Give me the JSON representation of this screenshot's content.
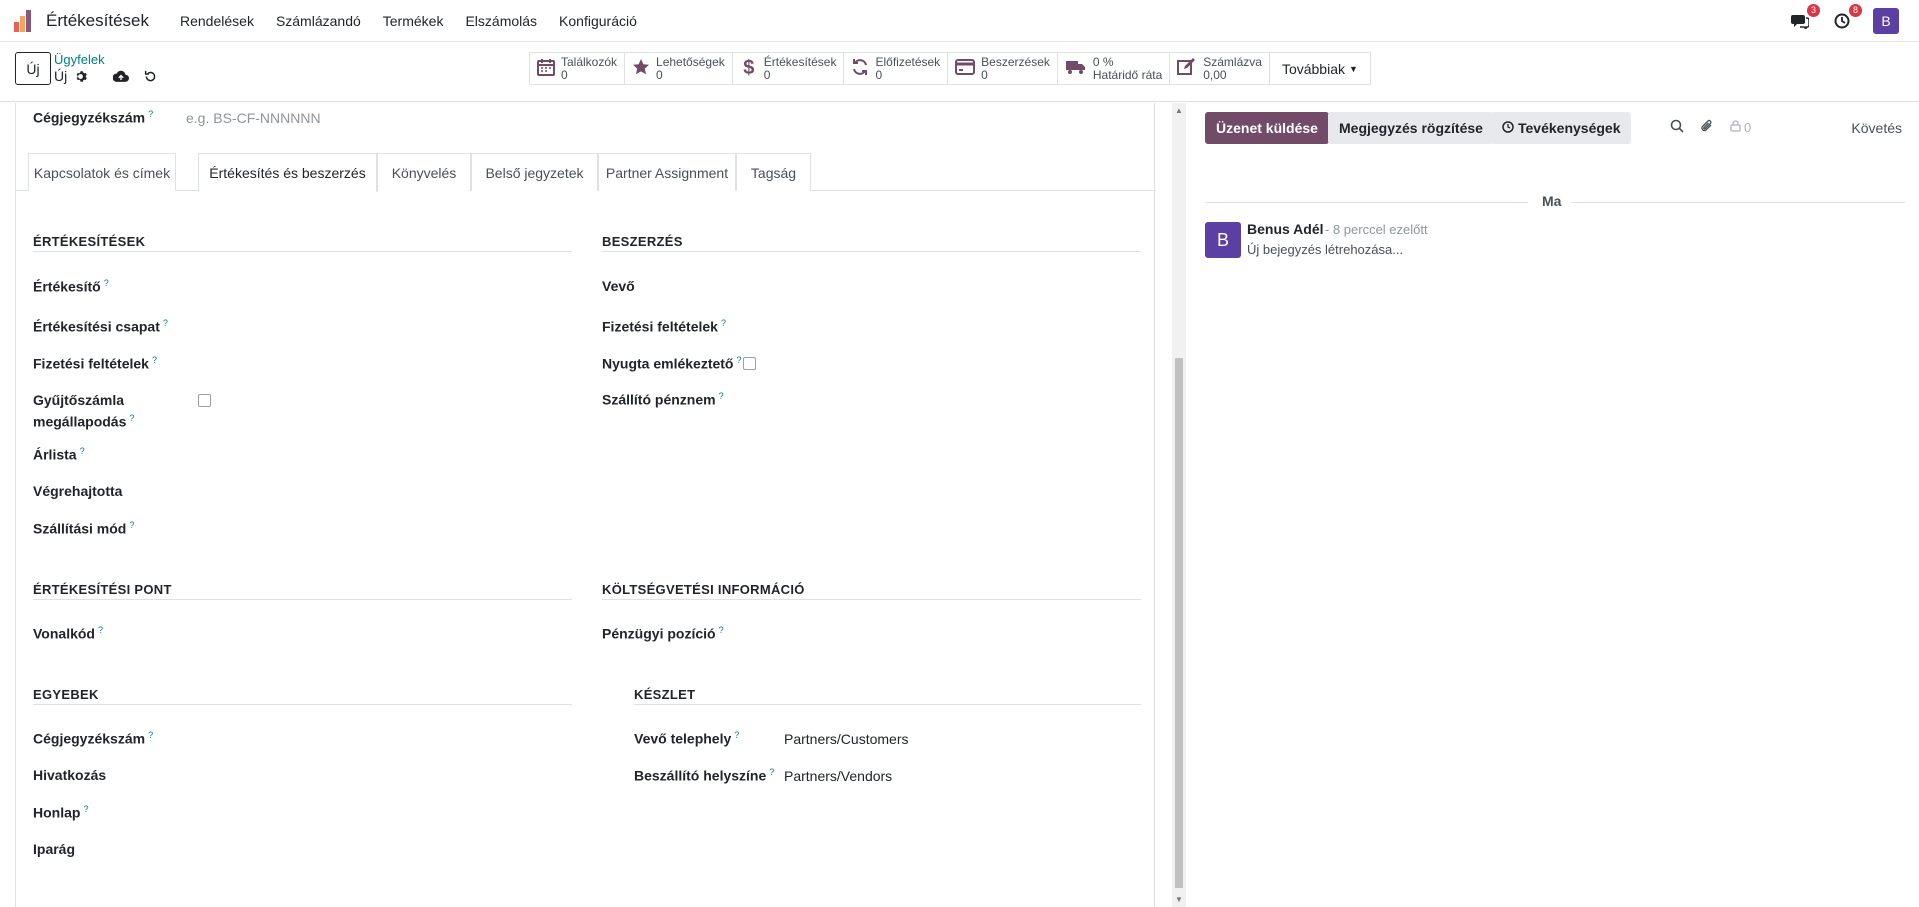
{
  "app": {
    "name": "Értékesítések",
    "menu": [
      "Rendelések",
      "Számlázandó",
      "Termékek",
      "Elszámolás",
      "Konfiguráció"
    ],
    "logo_colors": [
      "#f06050",
      "#f4a460",
      "#875a7b",
      "#1f8a70"
    ]
  },
  "navbar": {
    "chat_count": "3",
    "activity_count": "8",
    "user_initial": "B"
  },
  "control": {
    "new_label": "Új",
    "breadcrumb": "Ügyfelek",
    "record_name": "Új",
    "smart_buttons": [
      {
        "label": "Találkozók",
        "value": "0",
        "icon": "calendar-icon"
      },
      {
        "label": "Lehetőségek",
        "value": "0",
        "icon": "star-icon"
      },
      {
        "label": "Értékesítések",
        "value": "0",
        "icon": "dollar-icon"
      },
      {
        "label": "Előfizetések",
        "value": "0",
        "icon": "refresh-icon"
      },
      {
        "label": "Beszerzések",
        "value": "0",
        "icon": "credit-card-icon"
      },
      {
        "label": "0 %",
        "value": "Határidő ráta",
        "icon": "truck-icon"
      },
      {
        "label": "Számlázva",
        "value": "0,00",
        "icon": "edit-icon"
      }
    ],
    "more_label": "Továbbiak"
  },
  "form": {
    "company_reg_label": "Cégjegyzékszám",
    "company_reg_placeholder": "e.g. BS-CF-NNNNNN",
    "tabs": [
      "Kapcsolatok és címek",
      "Értékesítés és beszerzés",
      "Könyvelés",
      "Belső jegyzetek",
      "Partner Assignment",
      "Tagság"
    ],
    "active_tab": "Értékesítés és beszerzés",
    "sales": {
      "title": "ÉRTÉKESÍTÉSEK",
      "salesperson": "Értékesítő",
      "sales_team": "Értékesítési csapat",
      "payment_terms": "Fizetési feltételek",
      "consolidated_line1": "Gyűjtőszámla",
      "consolidated_line2": "megállapodás",
      "pricelist": "Árlista",
      "executed_by": "Végrehajtotta",
      "delivery_method": "Szállítási mód"
    },
    "purchase": {
      "title": "BESZERZÉS",
      "buyer": "Vevő",
      "payment_terms": "Fizetési feltételek",
      "receipt_reminder": "Nyugta emlékeztető",
      "supplier_currency": "Szállító pénznem"
    },
    "pos": {
      "title": "ÉRTÉKESÍTÉSI PONT",
      "barcode": "Vonalkód"
    },
    "fiscal": {
      "title": "KÖLTSÉGVETÉSI INFORMÁCIÓ",
      "fiscal_position": "Pénzügyi pozíció"
    },
    "misc": {
      "title": "EGYEBEK",
      "company_reg": "Cégjegyzékszám",
      "reference": "Hivatkozás",
      "website": "Honlap",
      "industry": "Iparág"
    },
    "inventory": {
      "title": "KÉSZLET",
      "customer_location": "Vevő telephely",
      "customer_location_value": "Partners/Customers",
      "vendor_location": "Beszállító helyszíne",
      "vendor_location_value": "Partners/Vendors"
    }
  },
  "chatter": {
    "send_message": "Üzenet küldése",
    "log_note": "Megjegyzés rögzítése",
    "activities": "Tevékenységek",
    "follower_count": "0",
    "follow": "Követés",
    "date_separator": "Ma",
    "message": {
      "avatar_initial": "B",
      "author": "Benus Adél",
      "time": "- 8 perccel ezelőtt",
      "body": "Új bejegyzés létrehozása..."
    }
  },
  "colors": {
    "primary": "#714b67",
    "link": "#017e84",
    "badge": "#dc3545",
    "avatar": "#5b3fa3"
  }
}
